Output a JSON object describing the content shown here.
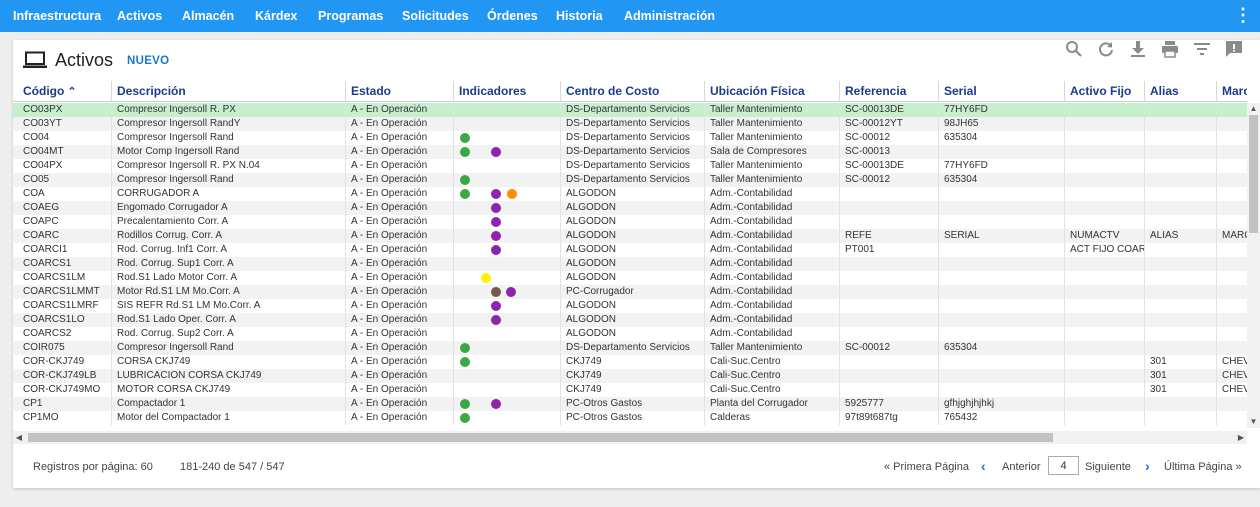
{
  "nav": {
    "items": [
      "Infraestructura",
      "Activos",
      "Almacén",
      "Kárdex",
      "Programas",
      "Solicitudes",
      "Órdenes",
      "Historia",
      "Administración"
    ],
    "more_icon": "more-vertical-icon"
  },
  "header": {
    "title": "Activos",
    "new_label": "NUEVO",
    "title_icon": "laptop-icon",
    "tools": [
      "search-icon",
      "refresh-icon",
      "download-icon",
      "print-icon",
      "filter-icon",
      "comment-icon"
    ]
  },
  "colors": {
    "nav_bg": "#2196f3",
    "header_text": "#1a3c8a",
    "selected_row": "#c6efce",
    "accent": "#1976d2",
    "dot_green": "#3aa843",
    "dot_purple": "#8e24aa",
    "dot_orange": "#ff8c00",
    "dot_yellow": "#fff200",
    "dot_brown": "#7a5545"
  },
  "table": {
    "columns": [
      "Código",
      "Descripción",
      "Estado",
      "Indicadores",
      "Centro de Costo",
      "Ubicación Física",
      "Referencia",
      "Serial",
      "Activo Fijo",
      "Alias",
      "Marca"
    ],
    "sort_indicator": "sort-ascending-icon",
    "rows": [
      {
        "c": [
          "CO03PX",
          "Compresor Ingersoll R. PX",
          "A - En Operación",
          "",
          "DS-Departamento Servicios",
          "Taller Mantenimiento",
          "SC-00013DE",
          "77HY6FD",
          "",
          "",
          ""
        ],
        "dots": [],
        "selected": true
      },
      {
        "c": [
          "CO03YT",
          "Compresor Ingersoll RandY",
          "A - En Operación",
          "",
          "DS-Departamento Servicios",
          "Taller Mantenimiento",
          "SC-00012YT",
          "98JH65",
          "",
          "",
          ""
        ],
        "dots": []
      },
      {
        "c": [
          "CO04",
          "Compresor Ingersoll Rand",
          "A - En Operación",
          "",
          "DS-Departamento Servicios",
          "Taller Mantenimiento",
          "SC-00012",
          "635304",
          "",
          "",
          ""
        ],
        "dots": [
          "green"
        ]
      },
      {
        "c": [
          "CO04MT",
          "Motor Comp Ingersoll Rand",
          "A - En Operación",
          "",
          "DS-Departamento Servicios",
          "Sala de Compresores",
          "SC-00013",
          "",
          "",
          "",
          ""
        ],
        "dots": [
          "green",
          "",
          "purple"
        ]
      },
      {
        "c": [
          "CO04PX",
          "Compresor Ingersoll R. PX N.04",
          "A - En Operación",
          "",
          "DS-Departamento Servicios",
          "Taller Mantenimiento",
          "SC-00013DE",
          "77HY6FD",
          "",
          "",
          ""
        ],
        "dots": []
      },
      {
        "c": [
          "CO05",
          "Compresor Ingersoll Rand",
          "A - En Operación",
          "",
          "DS-Departamento Servicios",
          "Taller Mantenimiento",
          "SC-00012",
          "635304",
          "",
          "",
          ""
        ],
        "dots": [
          "green"
        ]
      },
      {
        "c": [
          "COA",
          "CORRUGADOR A",
          "A - En Operación",
          "",
          "ALGODON",
          "Adm.-Contabilidad",
          "",
          "",
          "",
          "",
          ""
        ],
        "dots": [
          "green",
          "",
          "purple",
          "orange"
        ]
      },
      {
        "c": [
          "COAEG",
          "Engomado Corrugador A",
          "A - En Operación",
          "",
          "ALGODON",
          "Adm.-Contabilidad",
          "",
          "",
          "",
          "",
          ""
        ],
        "dots": [
          "",
          "",
          "purple"
        ]
      },
      {
        "c": [
          "COAPC",
          "Precalentamiento Corr. A",
          "A - En Operación",
          "",
          "ALGODON",
          "Adm.-Contabilidad",
          "",
          "",
          "",
          "",
          ""
        ],
        "dots": [
          "",
          "",
          "purple"
        ]
      },
      {
        "c": [
          "COARC",
          "Rodillos Corrug. Corr. A",
          "A - En Operación",
          "",
          "ALGODON",
          "Adm.-Contabilidad",
          "REFE",
          "SERIAL",
          "NUMACTV",
          "ALIAS",
          "MARCA"
        ],
        "dots": [
          "",
          "",
          "purple"
        ]
      },
      {
        "c": [
          "COARCI1",
          "Rod. Corrug. Inf1 Corr. A",
          "A - En Operación",
          "",
          "ALGODON",
          "Adm.-Contabilidad",
          "PT001",
          "",
          "ACT FIJO COAR",
          "",
          ""
        ],
        "dots": [
          "",
          "",
          "purple"
        ]
      },
      {
        "c": [
          "COARCS1",
          "Rod. Corrug. Sup1 Corr. A",
          "A - En Operación",
          "",
          "ALGODON",
          "Adm.-Contabilidad",
          "",
          "",
          "",
          "",
          ""
        ],
        "dots": []
      },
      {
        "c": [
          "COARCS1LM",
          "Rod.S1 Lado Motor Corr. A",
          "A - En Operación",
          "",
          "ALGODON",
          "Adm.-Contabilidad",
          "",
          "",
          "",
          "",
          ""
        ],
        "dots": [
          "",
          "yellow"
        ]
      },
      {
        "c": [
          "COARCS1LMMT",
          "Motor Rd.S1 LM Mo.Corr. A",
          "A - En Operación",
          "",
          "PC-Corrugador",
          "Adm.-Contabilidad",
          "",
          "",
          "",
          "",
          ""
        ],
        "dots": [
          "",
          "",
          "brown",
          "purple"
        ],
        "dotmode": "pair"
      },
      {
        "c": [
          "COARCS1LMRF",
          "SIS REFR Rd.S1 LM Mo.Corr. A",
          "A - En Operación",
          "",
          "ALGODON",
          "Adm.-Contabilidad",
          "",
          "",
          "",
          "",
          ""
        ],
        "dots": [
          "",
          "",
          "purple"
        ]
      },
      {
        "c": [
          "COARCS1LO",
          "Rod.S1 Lado Oper. Corr. A",
          "A - En Operación",
          "",
          "ALGODON",
          "Adm.-Contabilidad",
          "",
          "",
          "",
          "",
          ""
        ],
        "dots": [
          "",
          "",
          "purple"
        ]
      },
      {
        "c": [
          "COARCS2",
          "Rod. Corrug. Sup2 Corr. A",
          "A - En Operación",
          "",
          "ALGODON",
          "Adm.-Contabilidad",
          "",
          "",
          "",
          "",
          ""
        ],
        "dots": []
      },
      {
        "c": [
          "COIR075",
          "Compresor Ingersoll Rand",
          "A - En Operación",
          "",
          "DS-Departamento Servicios",
          "Taller Mantenimiento",
          "SC-00012",
          "635304",
          "",
          "",
          ""
        ],
        "dots": [
          "green"
        ]
      },
      {
        "c": [
          "COR-CKJ749",
          "CORSA CKJ749",
          "A - En Operación",
          "",
          "CKJ749",
          "Cali-Suc.Centro",
          "",
          "",
          "",
          "301",
          "CHEVROLET"
        ],
        "dots": [
          "green"
        ]
      },
      {
        "c": [
          "COR-CKJ749LB",
          "LUBRICACION CORSA CKJ749",
          "A - En Operación",
          "",
          "CKJ749",
          "Cali-Suc.Centro",
          "",
          "",
          "",
          "301",
          "CHEVROLET"
        ],
        "dots": []
      },
      {
        "c": [
          "COR-CKJ749MO",
          "MOTOR CORSA CKJ749",
          "A - En Operación",
          "",
          "CKJ749",
          "Cali-Suc.Centro",
          "",
          "",
          "",
          "301",
          "CHEVROLET"
        ],
        "dots": []
      },
      {
        "c": [
          "CP1",
          "Compactador 1",
          "A - En Operación",
          "",
          "PC-Otros Gastos",
          "Planta del Corrugador",
          "5925777",
          "gfhjghjhjhkj",
          "",
          "",
          ""
        ],
        "dots": [
          "green",
          "",
          "purple"
        ]
      },
      {
        "c": [
          "CP1MO",
          "Motor del Compactador 1",
          "A - En Operación",
          "",
          "PC-Otros Gastos",
          "Calderas",
          "97t89t687tg",
          "765432",
          "",
          "",
          ""
        ],
        "dots": [
          "green"
        ]
      }
    ]
  },
  "footer": {
    "per_page": "Registros por página: 60",
    "range": "181-240 de 547 / 547",
    "first": "« Primera Página",
    "prev": "Anterior",
    "page": "4",
    "next": "Siguiente",
    "last": "Última Página »"
  }
}
